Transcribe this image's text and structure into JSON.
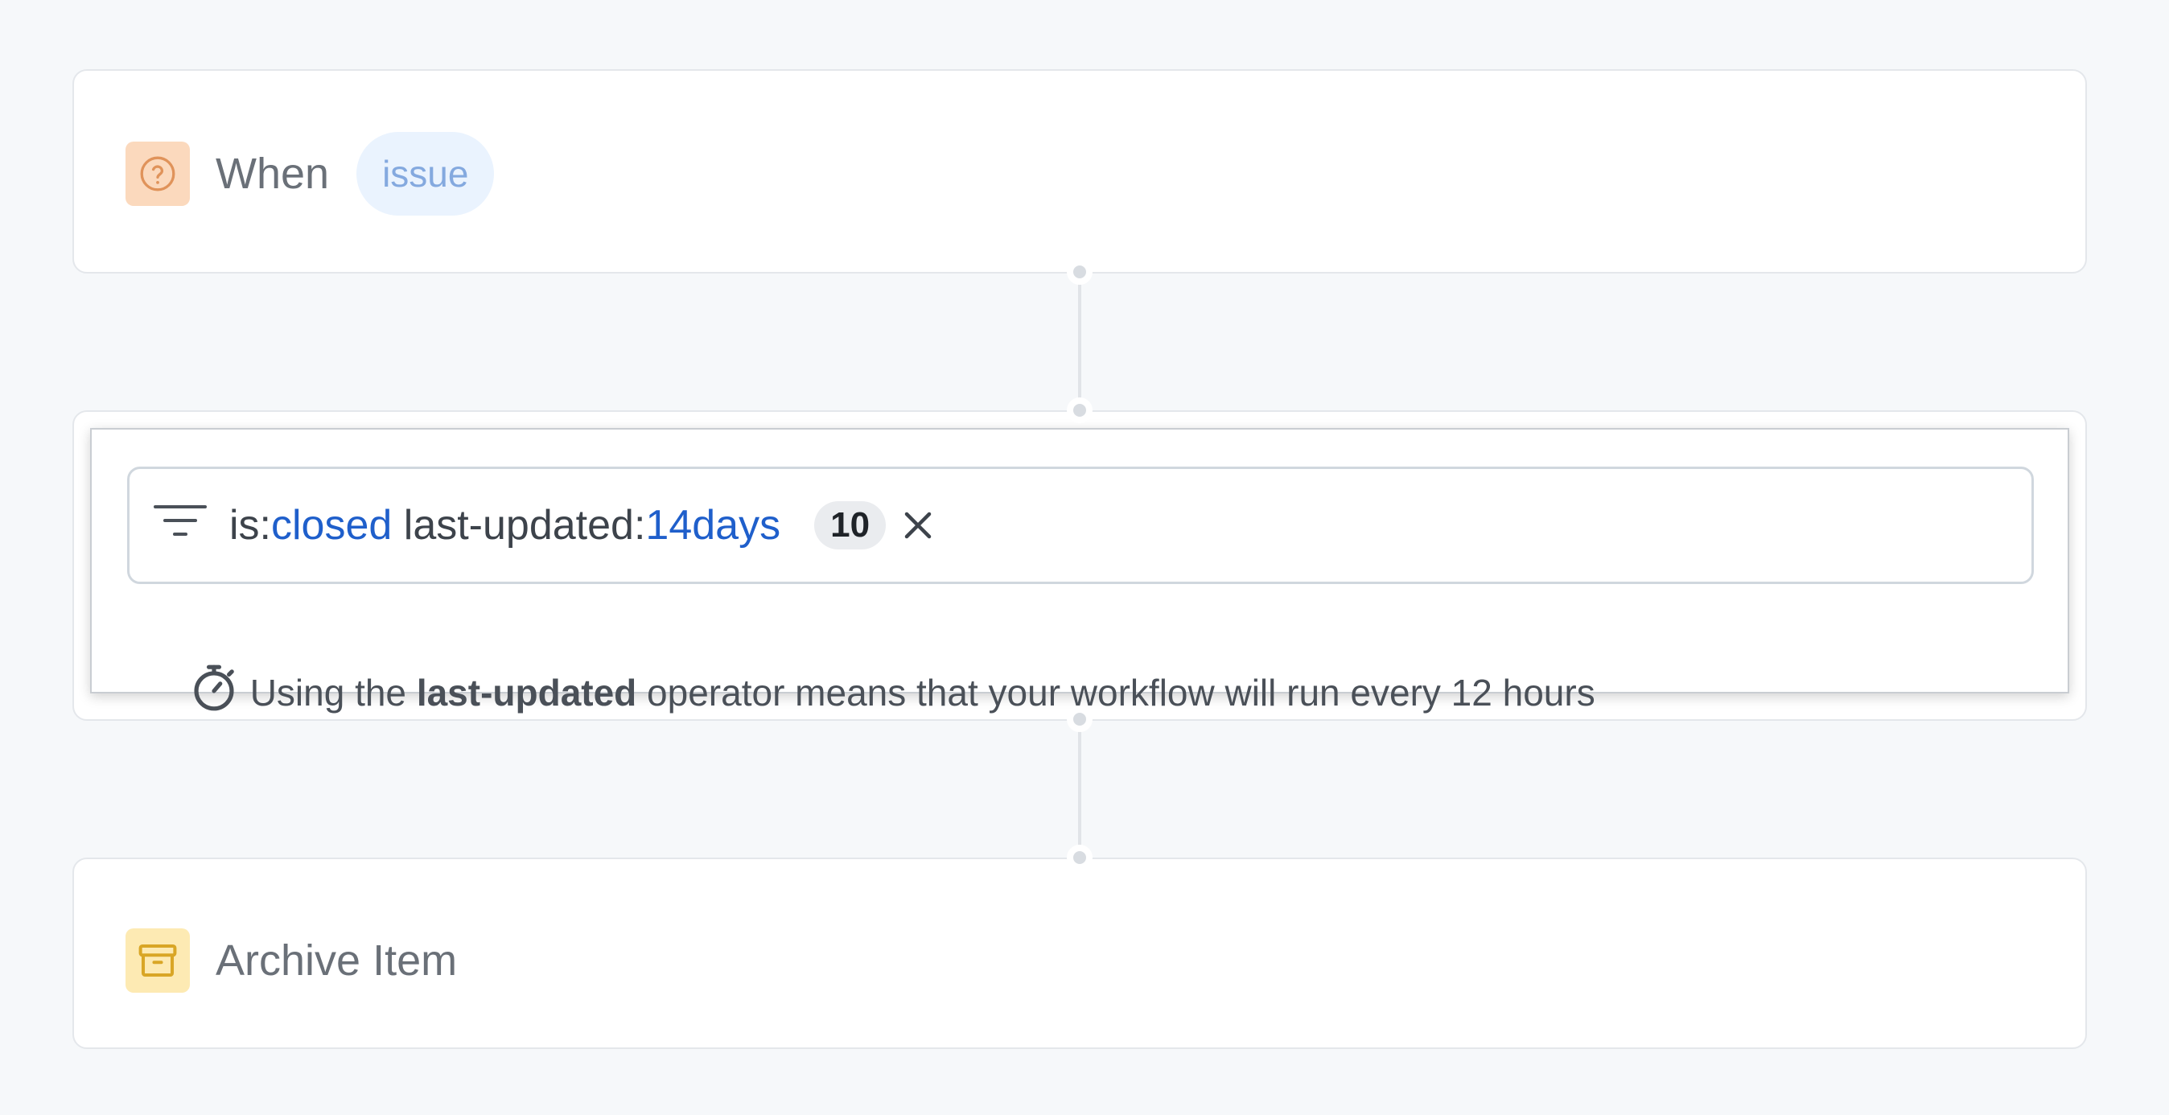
{
  "trigger": {
    "when_label": "When",
    "item_type": "issue",
    "icon": "question-circle-icon"
  },
  "filter": {
    "icon": "filter-icon",
    "query_parts": [
      {
        "text": "is:",
        "style": "plain"
      },
      {
        "text": "closed",
        "style": "value"
      },
      {
        "text": " last-updated:",
        "style": "plain"
      },
      {
        "text": "14days",
        "style": "value"
      }
    ],
    "result_count": "10",
    "clear_icon": "close-icon",
    "hint": {
      "icon": "stopwatch-icon",
      "prefix": "Using the ",
      "keyword": "last-updated",
      "suffix": " operator means that your workflow will run every 12 hours"
    }
  },
  "action": {
    "label": "Archive Item",
    "icon": "archive-icon"
  },
  "colors": {
    "accent_blue": "#1f5fcb",
    "trigger_icon_bg": "#fbd9bd",
    "action_icon_bg": "#fdeab3",
    "pill_bg": "#eaf3fe",
    "pill_text": "#84a9df"
  }
}
